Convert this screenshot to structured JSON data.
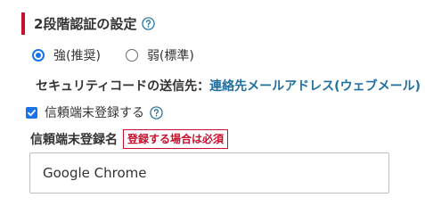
{
  "section": {
    "title": "2段階認証の設定"
  },
  "strength": {
    "options": [
      {
        "label": "強(推奨)",
        "selected": true
      },
      {
        "label": "弱(標準)",
        "selected": false
      }
    ]
  },
  "security_code": {
    "label": "セキュリティコードの送信先：",
    "destination": "連絡先メールアドレス(ウェブメール)"
  },
  "trusted_device": {
    "checkbox_label": "信頼端末登録する",
    "checked": true,
    "name_label": "信頼端末登録名",
    "required_badge": "登録する場合は必須",
    "name_value": "Google Chrome"
  },
  "colors": {
    "accent": "#c8102e",
    "primary": "#1a73e8",
    "link": "#1f6f9f"
  },
  "icons": {
    "help": "question-circle-icon"
  }
}
